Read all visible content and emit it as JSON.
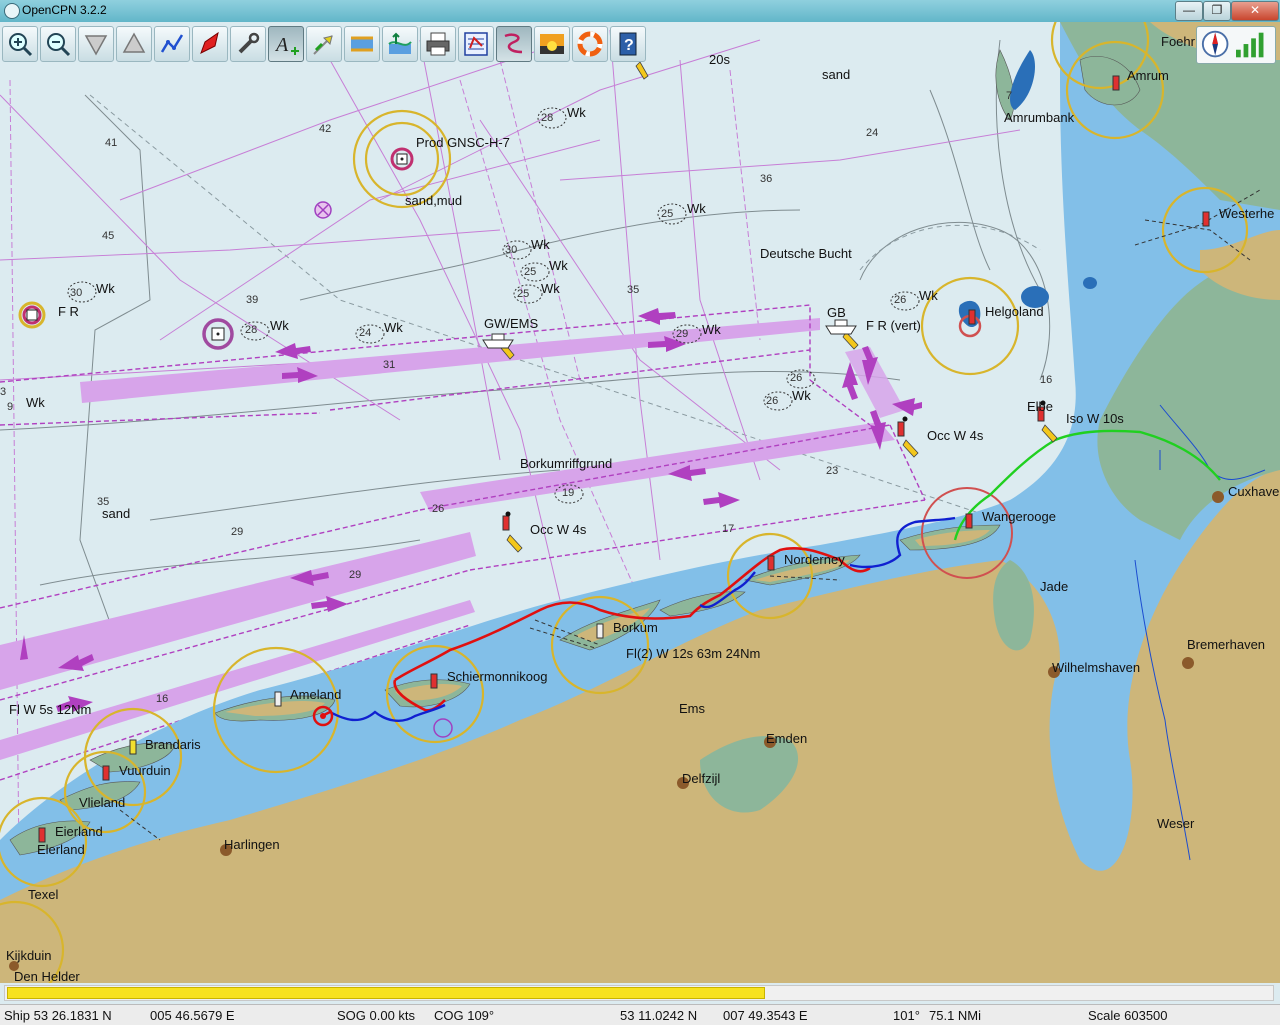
{
  "window": {
    "title": "OpenCPN 3.2.2",
    "minimize": "—",
    "maximize": "❐",
    "close": "✕"
  },
  "toolbar": {
    "tools": [
      {
        "name": "zoom-in",
        "icon": "zoom-in-icon"
      },
      {
        "name": "zoom-out",
        "icon": "zoom-out-icon"
      },
      {
        "name": "scale-down",
        "icon": "scale-down-icon"
      },
      {
        "name": "scale-up",
        "icon": "scale-up-icon"
      },
      {
        "name": "route",
        "icon": "route-icon"
      },
      {
        "name": "follow-ship",
        "icon": "ship-icon"
      },
      {
        "name": "settings",
        "icon": "wrench-icon"
      },
      {
        "name": "text",
        "icon": "text-icon"
      },
      {
        "name": "current",
        "icon": "current-icon"
      },
      {
        "name": "tide",
        "icon": "tide-icon"
      },
      {
        "name": "tide-graph",
        "icon": "tide-graph-icon"
      },
      {
        "name": "print",
        "icon": "printer-icon"
      },
      {
        "name": "route-manager",
        "icon": "route-manager-icon"
      },
      {
        "name": "track",
        "icon": "track-icon"
      },
      {
        "name": "color-scheme",
        "icon": "sunset-icon"
      },
      {
        "name": "mob",
        "icon": "lifebuoy-icon"
      },
      {
        "name": "help",
        "icon": "help-icon"
      }
    ]
  },
  "chart": {
    "places": {
      "foehr": "Foehr",
      "amrum": "Amrum",
      "amrumbank": "Amrumbank",
      "westerhever": "Westerhe",
      "helgoland": "Helgoland",
      "elbe": "Elbe",
      "iso_w": "Iso W 10s",
      "cuxhaven": "Cuxhaver",
      "deutsche_bucht": "Deutsche Bucht",
      "prod": "Prod GNSC-H-7",
      "sand_mud": "sand,mud",
      "sand_top": "sand",
      "sand_left": "sand",
      "gb": "GB",
      "fr_vert": "F R (vert)",
      "occ1": "Occ W 4s",
      "occ2": "Occ W 4s",
      "gwems": "GW/EMS",
      "borkumriffgrund": "Borkumriffgrund",
      "fr": "F R",
      "wangerooge": "Wangerooge",
      "norderney": "Norderney",
      "borkum": "Borkum",
      "borkum_light": "Fl(2) W 12s 63m 24Nm",
      "schiermonnikoog": "Schiermonnikoog",
      "ameland": "Ameland",
      "fl_w": "Fl W 5s 12Nm",
      "brandaris": "Brandaris",
      "vuurduin": "Vuurduin",
      "vlieland": "Vlieland",
      "eierland": "Eierland",
      "elerland": "Elerland",
      "texel": "Texel",
      "kijkduin": "Kijkduin",
      "den_helder": "Den Helder",
      "harlingen": "Harlingen",
      "ems": "Ems",
      "emden": "Emden",
      "delfzijl": "Delfzijl",
      "jade": "Jade",
      "wilhelmshaven": "Wilhelmshaven",
      "bremerhaven": "Bremerhaven",
      "weser": "Weser",
      "wk": "Wk",
      "scale_20s": "20s"
    },
    "depths": {
      "d41": "41",
      "d42": "42",
      "d45": "45",
      "d39": "39",
      "d24": "24",
      "d36": "36",
      "d35a": "35",
      "d31": "31",
      "d26": "26",
      "d29a": "29",
      "d29b": "29",
      "d23": "23",
      "d17": "17",
      "d16a": "16",
      "d16b": "16",
      "d35b": "35",
      "d9": "9",
      "d3": "3",
      "d7": "7",
      "d19": "19",
      "s28": "28",
      "s25a": "25",
      "s30a": "30",
      "s25b": "25",
      "s25c": "25",
      "s30b": "30",
      "s28b": "28",
      "s24": "24",
      "s29": "29",
      "s26a": "26",
      "s26b": "26",
      "s26c": "26"
    }
  },
  "progress": {
    "fraction": 0.6
  },
  "status": {
    "ship": "Ship 53 26.1831 N",
    "ship_lon": "005 46.5679 E",
    "sog": "SOG 0.00 kts",
    "cog": "COG 109°",
    "cursor_lat": "53 11.0242 N",
    "cursor_lon": "007 49.3543 E",
    "brg": "101°",
    "dist": "75.1 NMi",
    "scale": "Scale 603500"
  },
  "colors": {
    "sea": "#dcebf0",
    "shallow": "#82bfe8",
    "land": "#cdb67a",
    "flats": "#8db69a",
    "tss": "#d7a4ea",
    "track_red": "#e01010",
    "track_blue": "#1020d0",
    "track_green": "#20d020",
    "light_ring": "#d8b52c"
  }
}
